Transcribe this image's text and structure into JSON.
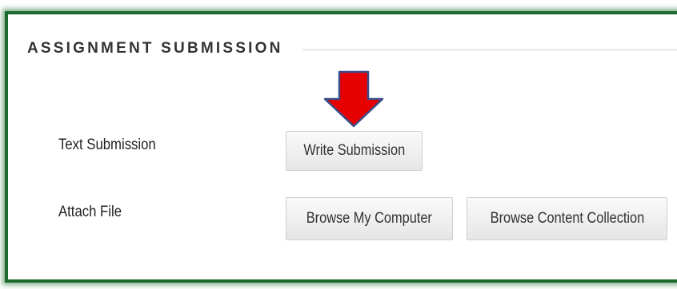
{
  "section": {
    "title": "ASSIGNMENT SUBMISSION"
  },
  "text_submission": {
    "label": "Text Submission",
    "button_label": "Write Submission"
  },
  "attach_file": {
    "label": "Attach File",
    "browse_computer_label": "Browse My Computer",
    "browse_collection_label": "Browse Content Collection"
  },
  "annotation": {
    "arrow_icon": "down-arrow-icon",
    "arrow_color": "#e60000",
    "arrow_outline_color": "#3a4f8a"
  },
  "colors": {
    "frame_border": "#1a6a2e",
    "button_border": "#cfcfcf",
    "text": "#333333"
  }
}
